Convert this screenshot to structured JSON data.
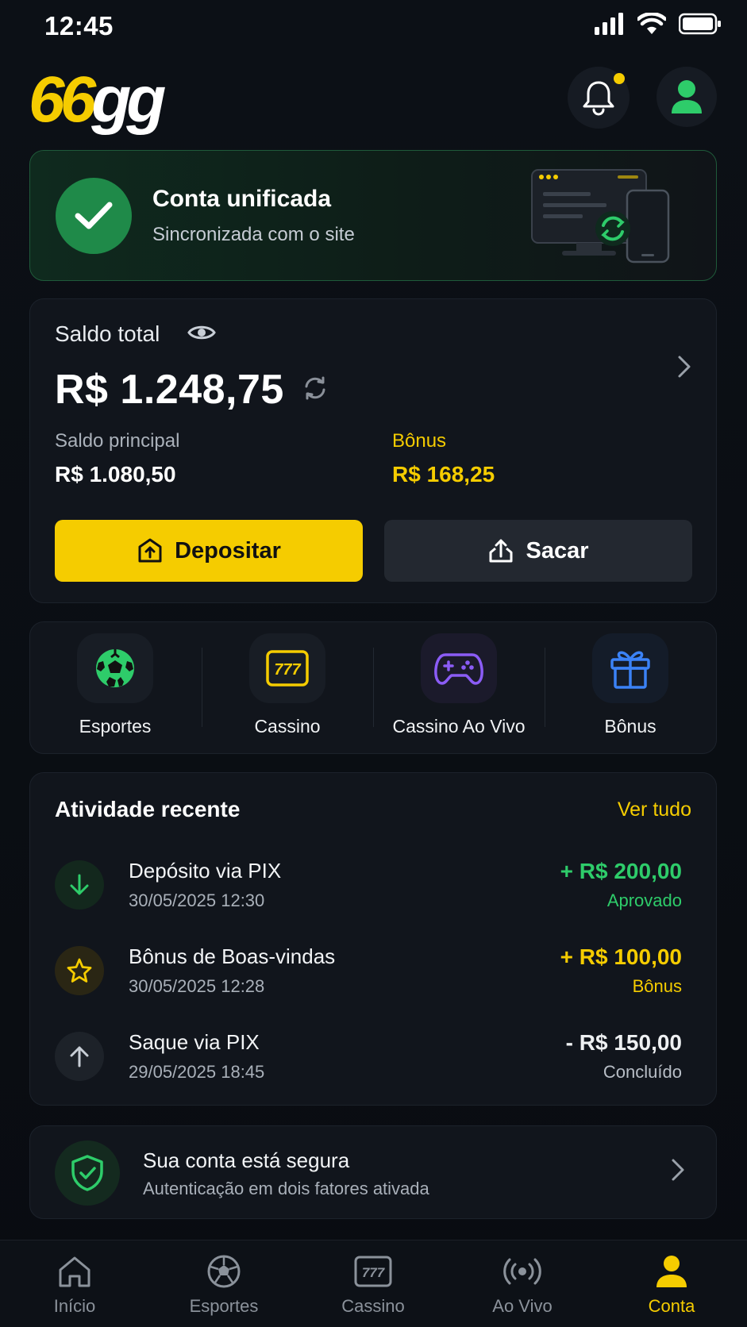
{
  "status_bar": {
    "time": "12:45"
  },
  "header": {
    "logo_part1": "66",
    "logo_part2": "gg",
    "has_notification": true
  },
  "unified": {
    "title": "Conta unificada",
    "subtitle": "Sincronizada com o site"
  },
  "balance": {
    "label": "Saldo total",
    "amount": "R$ 1.248,75",
    "main_label": "Saldo principal",
    "main_value": "R$ 1.080,50",
    "bonus_label": "Bônus",
    "bonus_value": "R$ 168,25",
    "deposit_label": "Depositar",
    "withdraw_label": "Sacar"
  },
  "quick_links": [
    {
      "label": "Esportes",
      "icon": "soccer-ball-icon"
    },
    {
      "label": "Cassino",
      "icon": "slot-777-icon"
    },
    {
      "label": "Cassino Ao Vivo",
      "icon": "gamepad-icon"
    },
    {
      "label": "Bônus",
      "icon": "gift-icon"
    }
  ],
  "activity": {
    "title": "Atividade recente",
    "link": "Ver tudo",
    "items": [
      {
        "name": "Depósito via PIX",
        "date": "30/05/2025 12:30",
        "amount": "+ R$ 200,00",
        "status": "Aprovado",
        "icon": "arrow-down-icon"
      },
      {
        "name": "Bônus de Boas-vindas",
        "date": "30/05/2025 12:28",
        "amount": "+ R$ 100,00",
        "status": "Bônus",
        "icon": "star-icon"
      },
      {
        "name": "Saque via PIX",
        "date": "29/05/2025 18:45",
        "amount": "- R$ 150,00",
        "status": "Concluído",
        "icon": "arrow-up-icon"
      }
    ]
  },
  "security": {
    "title": "Sua conta está segura",
    "subtitle": "Autenticação em dois fatores ativada"
  },
  "bottom_nav": [
    {
      "label": "Início",
      "icon": "home-icon"
    },
    {
      "label": "Esportes",
      "icon": "soccer-ball-icon"
    },
    {
      "label": "Cassino",
      "icon": "slot-777-icon"
    },
    {
      "label": "Ao Vivo",
      "icon": "live-broadcast-icon"
    },
    {
      "label": "Conta",
      "icon": "user-icon",
      "active": true
    }
  ],
  "colors": {
    "accent": "#f5cc00",
    "success": "#2ecc6a",
    "background": "#0a0d12",
    "card": "#11151c"
  }
}
